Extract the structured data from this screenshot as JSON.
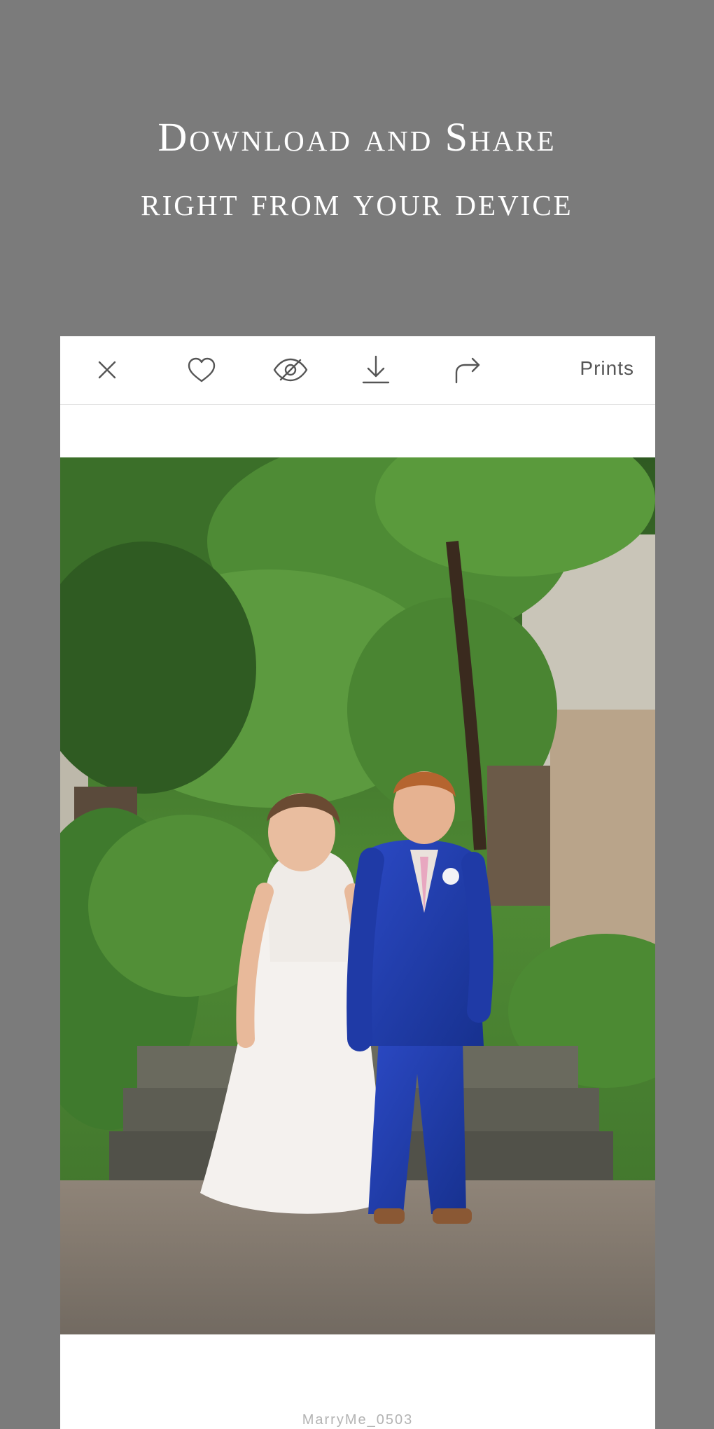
{
  "headline": {
    "line1": "Download and Share",
    "line2": "right from your device"
  },
  "toolbar": {
    "close_icon": "close-icon",
    "favorite_icon": "heart-icon",
    "hide_icon": "eye-slash-icon",
    "download_icon": "download-icon",
    "share_icon": "share-arrow-icon",
    "prints_label": "Prints"
  },
  "photo": {
    "caption": "MarryMe_0503"
  },
  "colors": {
    "background": "#7b7b7b",
    "card": "#ffffff",
    "icon": "#555555"
  }
}
